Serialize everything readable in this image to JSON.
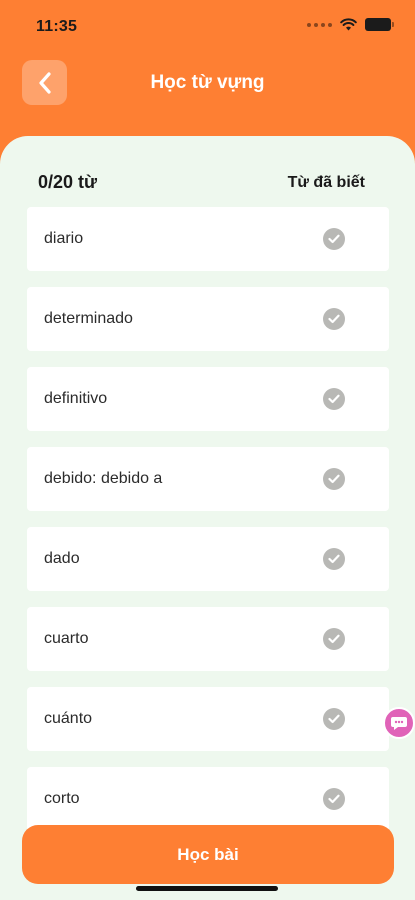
{
  "status_bar": {
    "time": "11:35",
    "icons": [
      "signal-dots-icon",
      "wifi-icon",
      "battery-icon"
    ]
  },
  "header": {
    "title": "Học từ vựng",
    "back_icon": "chevron-left-icon"
  },
  "list": {
    "count_label": "0/20 từ",
    "known_label": "Từ đã biết",
    "words": [
      "diario",
      "determinado",
      "definitivo",
      "debido: debido a",
      "dado",
      "cuarto",
      "cuánto",
      "corto"
    ],
    "check_icon": "check-circle-icon"
  },
  "floating_badge": {
    "icon": "chat-bubble-icon"
  },
  "footer": {
    "study_button_label": "Học bài"
  },
  "colors": {
    "accent": "#FE7F33",
    "panel_background": "#EEF8EE",
    "check_gray": "#B8B8B5",
    "badge_pink": "#E063B8"
  }
}
